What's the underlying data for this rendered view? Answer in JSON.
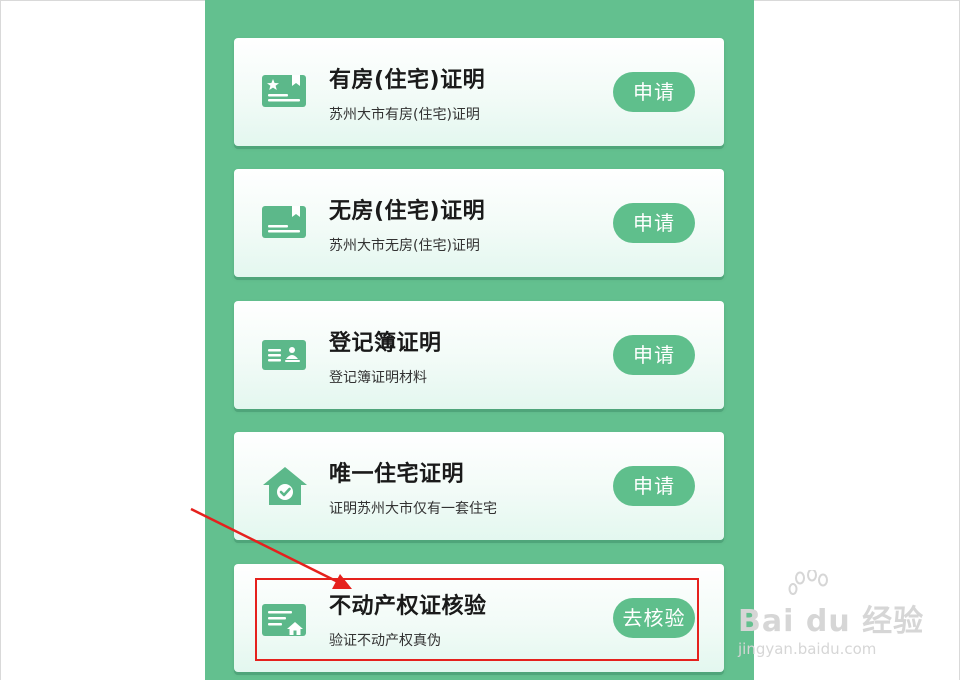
{
  "cards": [
    {
      "title": "有房(住宅)证明",
      "subtitle": "苏州大市有房(住宅)证明",
      "button": "申请",
      "icon": "certificate-star-icon"
    },
    {
      "title": "无房(住宅)证明",
      "subtitle": "苏州大市无房(住宅)证明",
      "button": "申请",
      "icon": "certificate-icon"
    },
    {
      "title": "登记簿证明",
      "subtitle": "登记簿证明材料",
      "button": "申请",
      "icon": "id-card-icon"
    },
    {
      "title": "唯一住宅证明",
      "subtitle": "证明苏州大市仅有一套住宅",
      "button": "申请",
      "icon": "house-check-icon"
    },
    {
      "title": "不动产权证核验",
      "subtitle": "验证不动产权真伪",
      "button": "去核验",
      "icon": "document-house-icon"
    }
  ],
  "watermark": {
    "brand": "Bai du 经验",
    "url": "jingyan.baidu.com"
  },
  "colors": {
    "panel": "#63c08f",
    "button": "#5fbf8c",
    "icon": "#5cb88a",
    "highlight": "#e5211d"
  }
}
